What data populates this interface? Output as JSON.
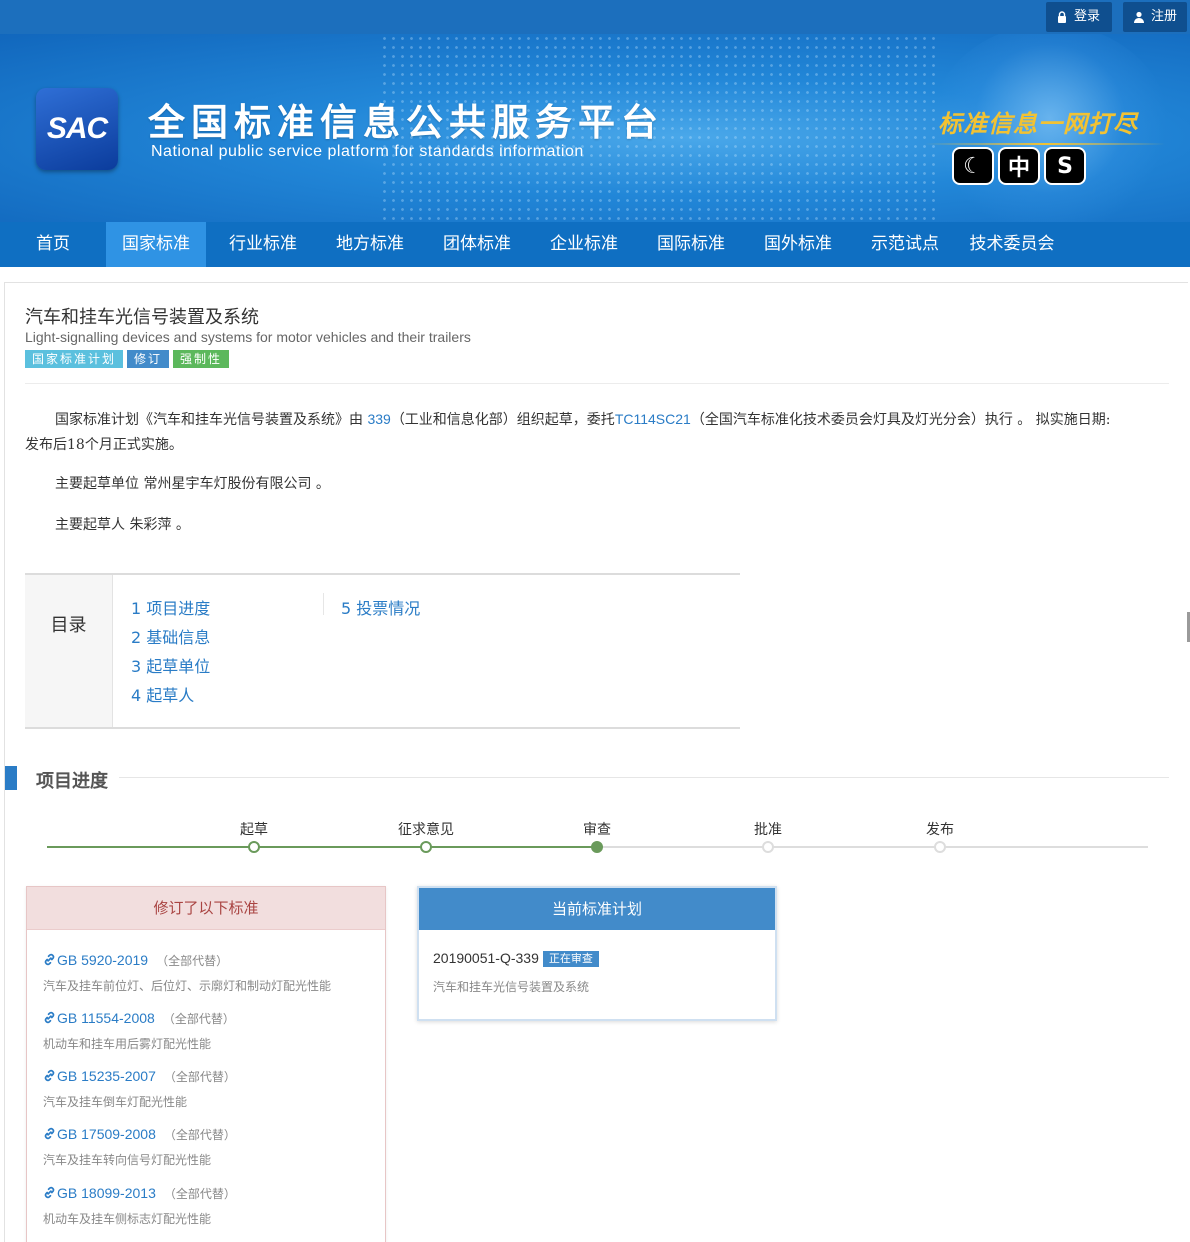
{
  "topbar": {
    "login_label": "登录",
    "register_label": "注册"
  },
  "banner": {
    "logo_text": "SAC",
    "title": "全国标准信息公共服务平台",
    "subtitle": "National public service platform  for standards information",
    "slogan": "标准信息一网打尽",
    "mode_buttons": [
      "☾",
      "中",
      "S"
    ]
  },
  "nav": {
    "items": [
      "首页",
      "国家标准",
      "行业标准",
      "地方标准",
      "团体标准",
      "企业标准",
      "国际标准",
      "国外标准",
      "示范试点",
      "技术委员会"
    ],
    "active_index": 1
  },
  "standard": {
    "title_cn": "汽车和挂车光信号装置及系统",
    "title_en": "Light-signalling devices and systems for motor vehicles and their trailers",
    "badges": [
      {
        "label": "国家标准计划",
        "color": "#5bc0de"
      },
      {
        "label": "修订",
        "color": "#428bca"
      },
      {
        "label": "强制性",
        "color": "#5cb85c"
      }
    ]
  },
  "description": {
    "p1_a": "国家标准计划《汽车和挂车光信号装置及系统》由 ",
    "p1_org_code": "339",
    "p1_b": "（工业和信息化部）组织起草，委托",
    "p1_tc_code": "TC114SC21",
    "p1_c": "（全国汽车标准化技术委员会灯具及灯光分会）执行 。 拟实施日期:",
    "p1_d": "发布后18个月正式实施。",
    "p2": "主要起草单位 常州星宇车灯股份有限公司 。",
    "p3": "主要起草人 朱彩萍 。"
  },
  "toc": {
    "heading": "目录",
    "items": [
      "1  项目进度",
      "2  基础信息",
      "3  起草单位",
      "4  起草人",
      "5  投票情况"
    ]
  },
  "progress": {
    "section_title": "项目进度",
    "stages": [
      "起草",
      "征求意见",
      "审查",
      "批准",
      "发布"
    ],
    "current_stage_index": 2,
    "done_color": "#6a9a5b",
    "todo_color": "#dddddd"
  },
  "revised_panel": {
    "heading": "修订了以下标准",
    "items": [
      {
        "code": "GB 5920-2019",
        "replace": "（全部代替）",
        "name": "汽车及挂车前位灯、后位灯、示廓灯和制动灯配光性能"
      },
      {
        "code": "GB 11554-2008",
        "replace": "（全部代替）",
        "name": "机动车和挂车用后雾灯配光性能"
      },
      {
        "code": "GB 15235-2007",
        "replace": "（全部代替）",
        "name": "汽车及挂车倒车灯配光性能"
      },
      {
        "code": "GB 17509-2008",
        "replace": "（全部代替）",
        "name": "汽车及挂车转向信号灯配光性能"
      },
      {
        "code": "GB 18099-2013",
        "replace": "（全部代替）",
        "name": "机动车及挂车侧标志灯配光性能"
      }
    ]
  },
  "plan_panel": {
    "heading": "当前标准计划",
    "plan_code": "20190051-Q-339",
    "status": "正在审查",
    "plan_name": "汽车和挂车光信号装置及系统"
  }
}
